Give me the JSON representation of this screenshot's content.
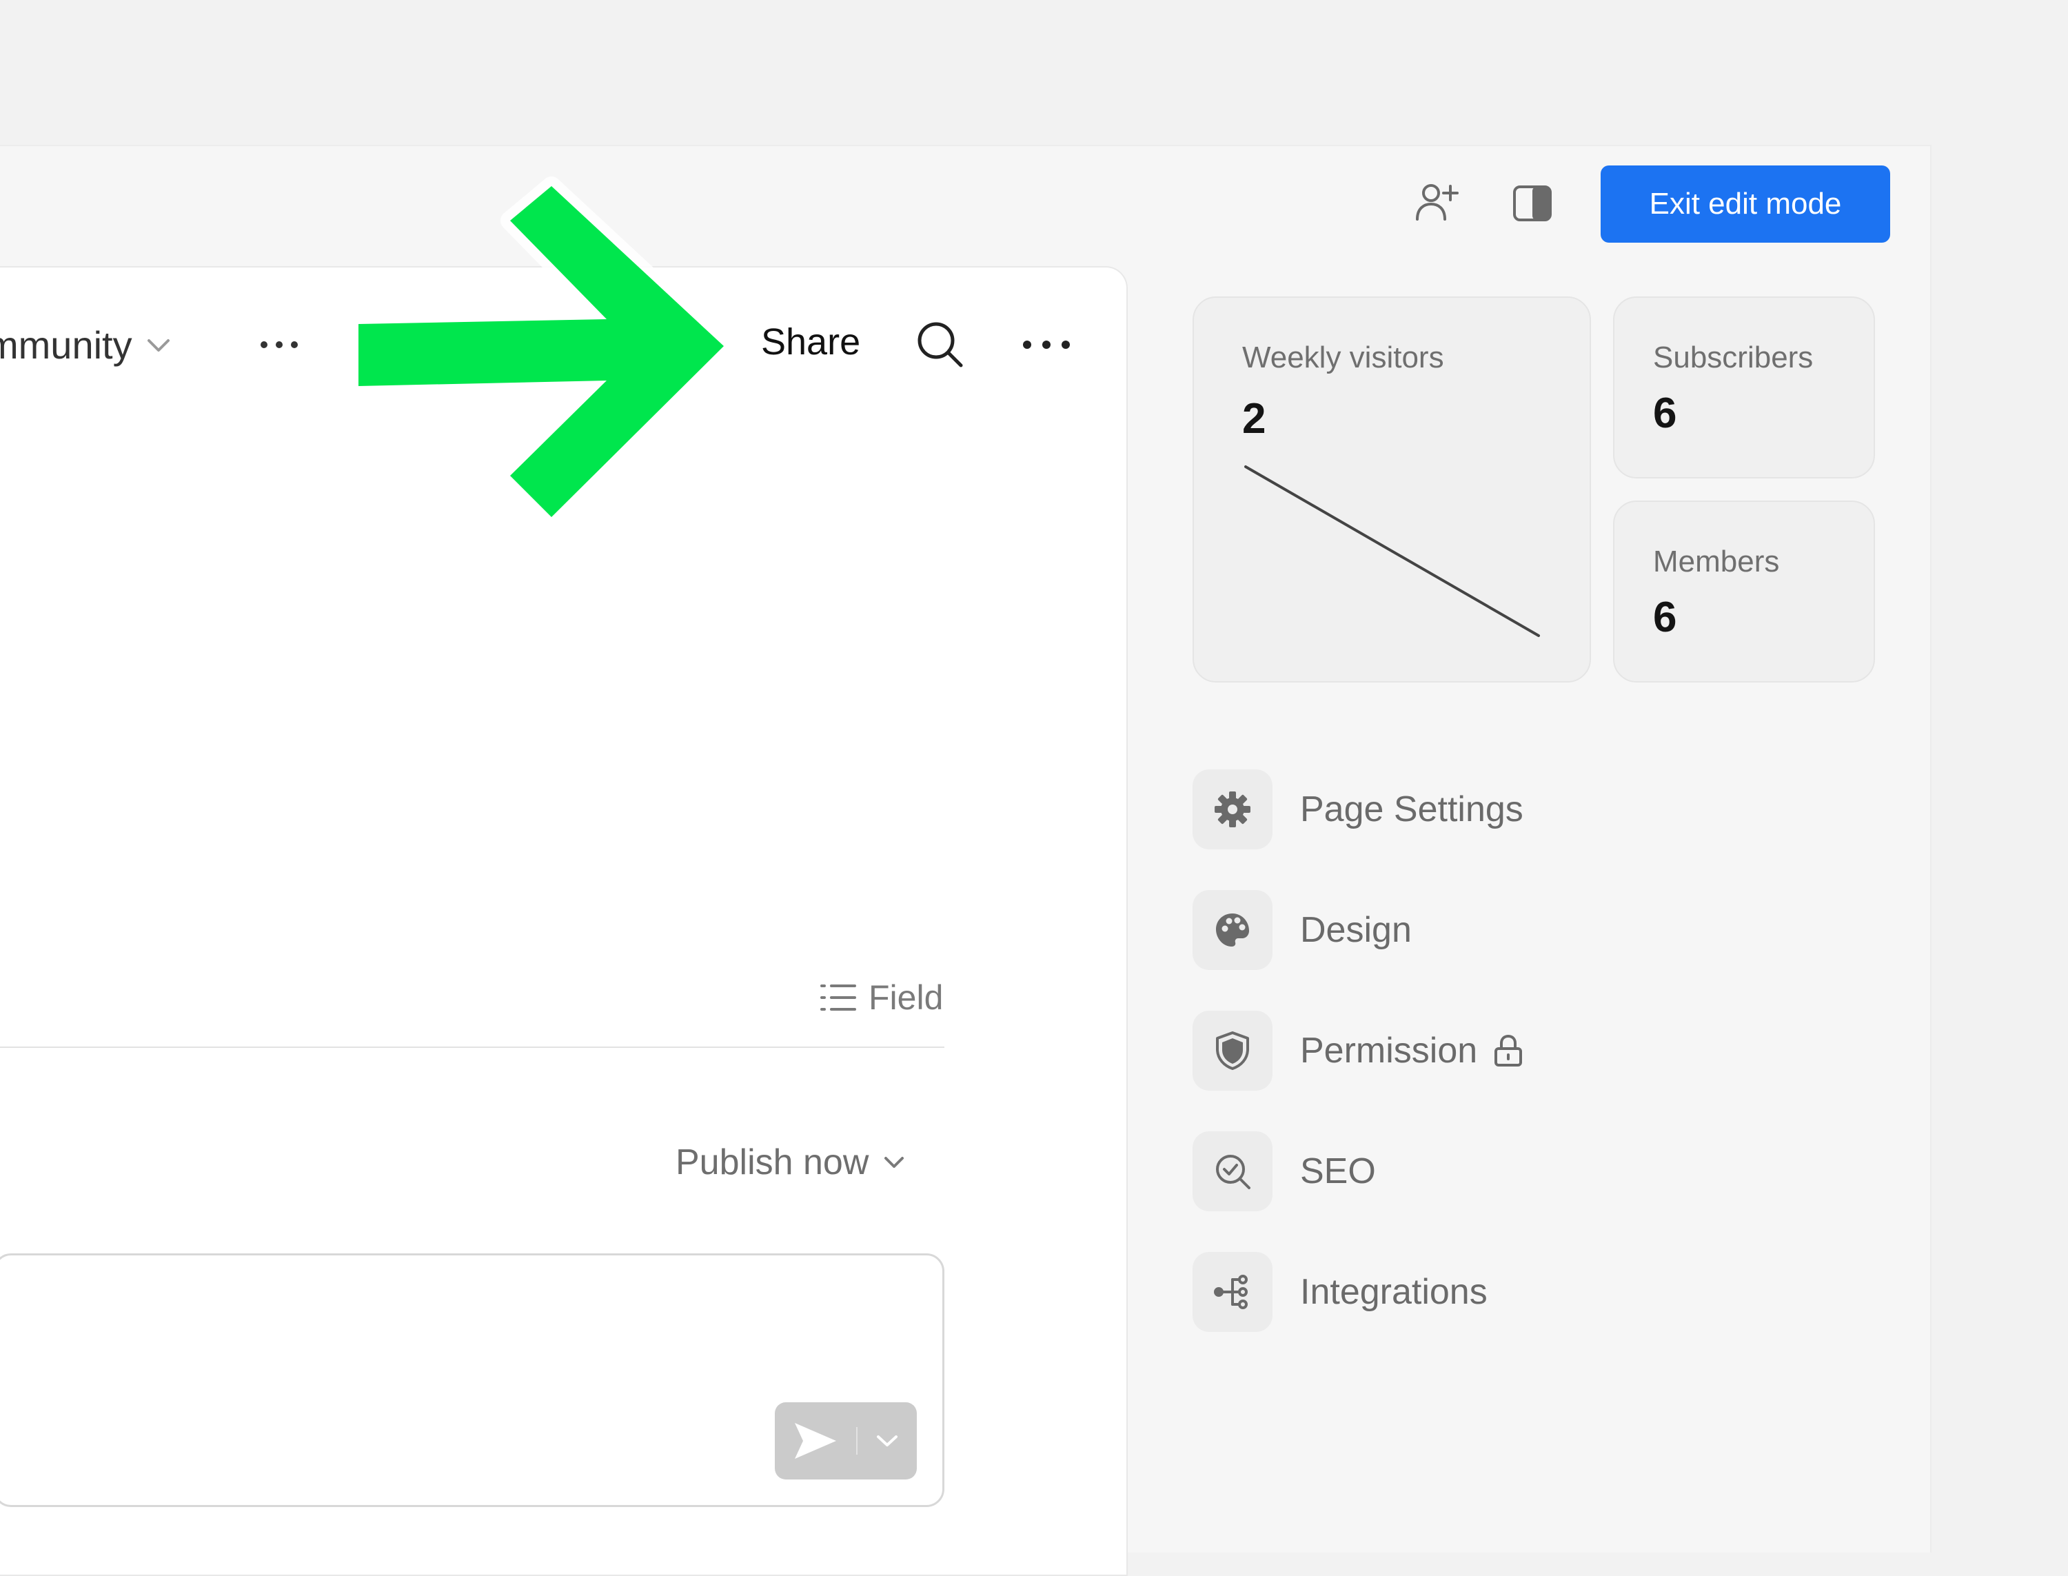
{
  "toolbar": {
    "invite_icon": "add-user-icon",
    "panel_icon": "panel-toggle-icon",
    "exit_label": "Exit edit mode",
    "accent": "#1c73f2"
  },
  "header": {
    "breadcrumb": "mmunity",
    "share_label": "Share"
  },
  "editor": {
    "field_label": "Field",
    "publish_label": "Publish now"
  },
  "stats": {
    "weekly_visitors": {
      "label": "Weekly visitors",
      "value": "2",
      "trend": [
        1,
        0
      ]
    },
    "subscribers": {
      "label": "Subscribers",
      "value": "6"
    },
    "members": {
      "label": "Members",
      "value": "6"
    }
  },
  "menu": [
    {
      "label": "Page Settings",
      "icon": "gear-icon"
    },
    {
      "label": "Design",
      "icon": "palette-icon"
    },
    {
      "label": "Permission",
      "icon": "shield-icon",
      "badge_icon": "lock-icon"
    },
    {
      "label": "SEO",
      "icon": "seo-check-icon"
    },
    {
      "label": "Integrations",
      "icon": "integrations-icon"
    }
  ],
  "annotation": {
    "color": "#00e64d"
  }
}
